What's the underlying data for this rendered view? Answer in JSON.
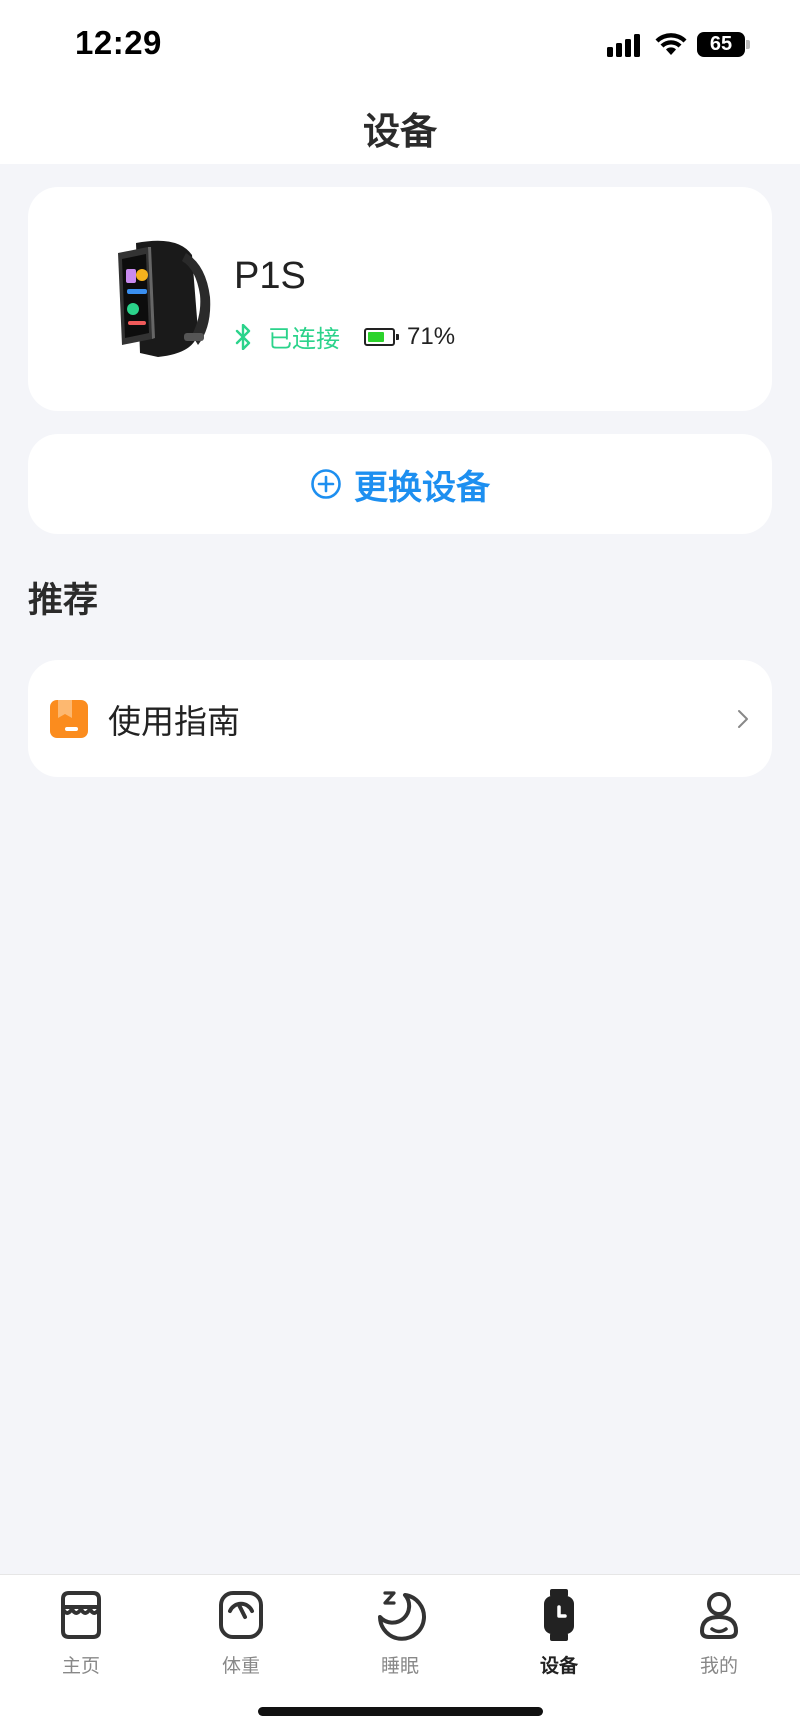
{
  "status_bar": {
    "time": "12:29",
    "battery": "65"
  },
  "header": {
    "title": "设备"
  },
  "device": {
    "name": "P1S",
    "connection_status": "已连接",
    "battery_percent": "71%",
    "battery_level": 0.71
  },
  "change_device": {
    "label": "更换设备"
  },
  "recommend": {
    "title": "推荐",
    "items": [
      {
        "label": "使用指南",
        "icon": "guide-book-icon"
      }
    ]
  },
  "tabbar": {
    "active": "设备",
    "items": [
      {
        "label": "主页",
        "icon": "home-icon"
      },
      {
        "label": "体重",
        "icon": "scale-icon"
      },
      {
        "label": "睡眠",
        "icon": "sleep-moon-icon"
      },
      {
        "label": "设备",
        "icon": "watch-icon"
      },
      {
        "label": "我的",
        "icon": "profile-icon"
      }
    ]
  },
  "colors": {
    "accent": "#1d8ff0",
    "connected": "#2bd38b",
    "battery_fill": "#2bd32b",
    "guide_icon": "#fb8c1e",
    "background": "#f4f5f9"
  }
}
